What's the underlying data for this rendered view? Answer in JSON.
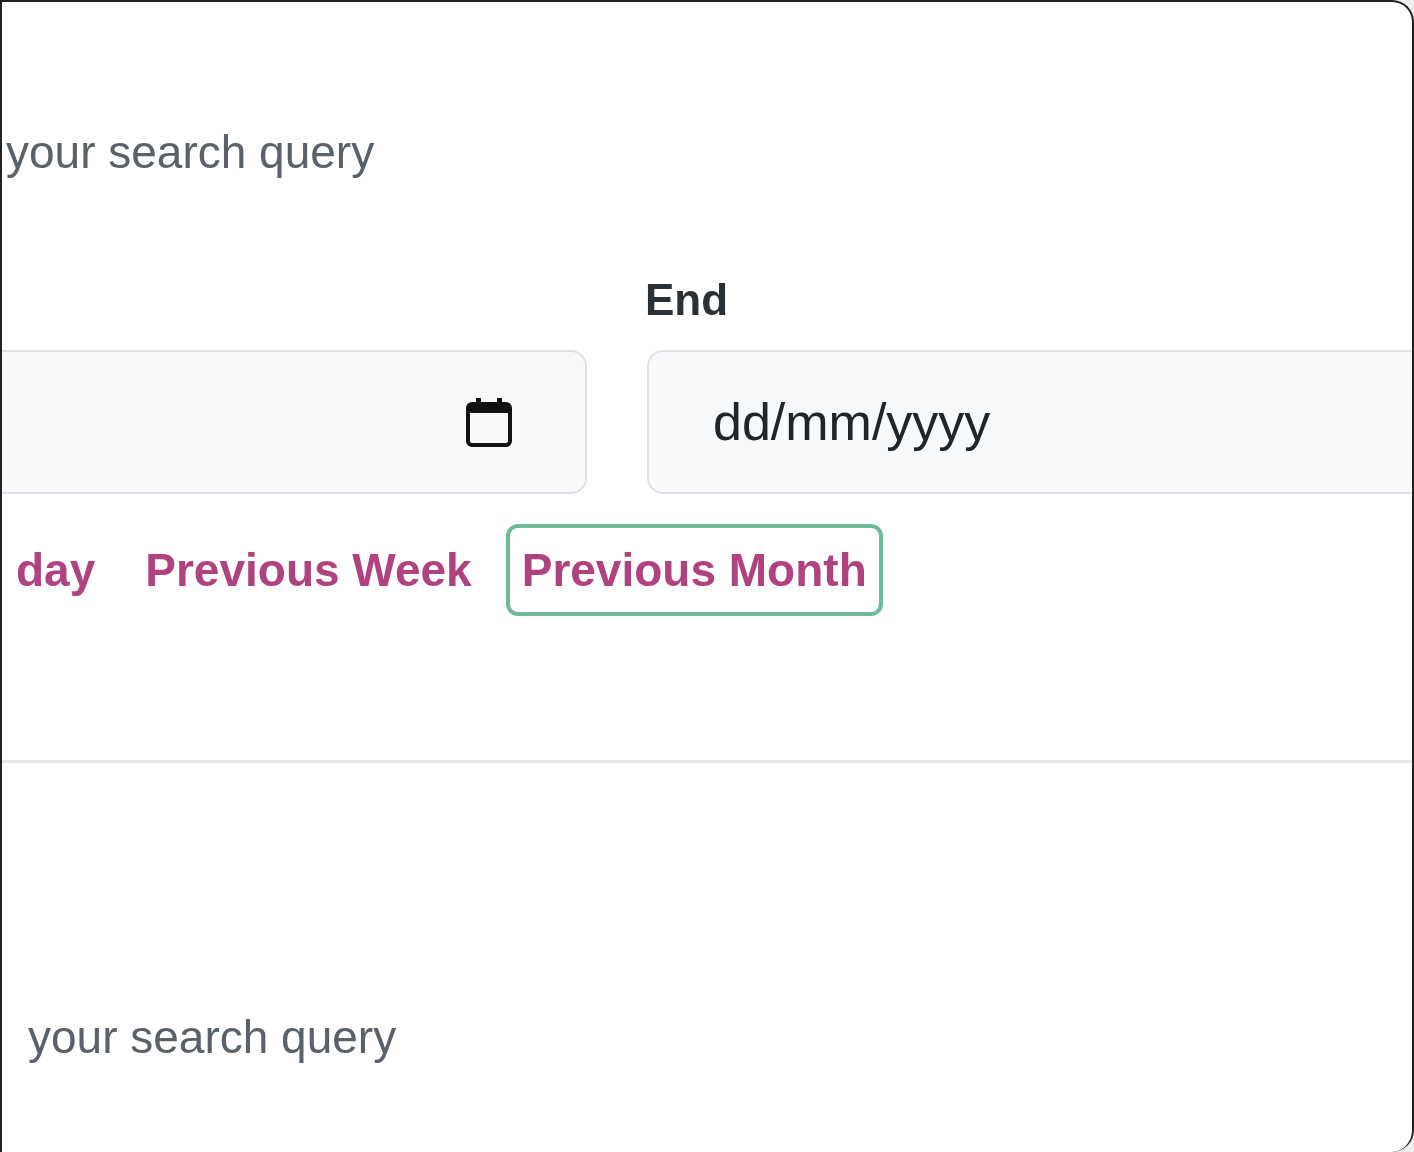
{
  "top_hint": "your search query",
  "end_label": "End",
  "end_field": {
    "placeholder": "dd/mm/yyyy"
  },
  "quick_links": [
    {
      "label": "day",
      "focused": false
    },
    {
      "label": "Previous Week",
      "focused": false
    },
    {
      "label": "Previous Month",
      "focused": true
    }
  ],
  "bottom_hint": "your search query"
}
